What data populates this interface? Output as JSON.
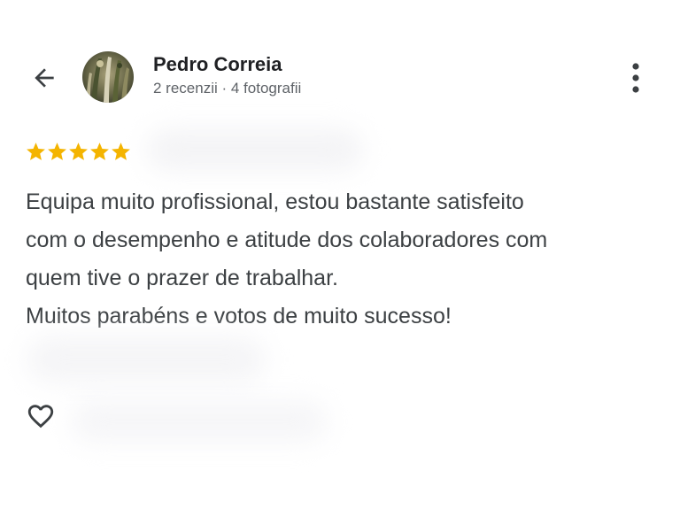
{
  "header": {
    "back_icon": "arrow-left-icon",
    "author_name": "Pedro Correia",
    "author_meta": "2 recenzii · 4 fotografii",
    "more_icon": "more-vert-icon"
  },
  "review": {
    "rating": 5,
    "rating_max": 5,
    "star_color": "#F4B400",
    "text": "Equipa muito profissional, estou bastante satisfeito\ncom o desempenho e atitude dos colaboradores com\nquem tive o prazer de trabalhar.\nMuitos parabéns e votos de muito sucesso!"
  },
  "actions": {
    "like_icon": "heart-outline-icon"
  }
}
